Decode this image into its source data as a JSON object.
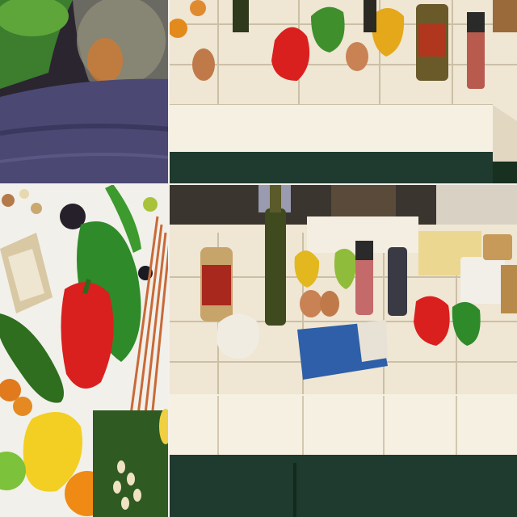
{
  "collage": {
    "panels": [
      {
        "id": "top-left",
        "scene": "close-up-fabric-and-fruit"
      },
      {
        "id": "top-right",
        "scene": "tiled-counter-with-peppers-and-cans"
      },
      {
        "id": "bottom-left",
        "scene": "vegetables-on-white-background"
      },
      {
        "id": "bottom-right",
        "scene": "kitchen-counter-with-ingredients"
      }
    ]
  },
  "colors": {
    "tile": "#f1e8d6",
    "grout": "#cbbfa6",
    "cabinet": "#1f3a2e",
    "red_pepper": "#d9201e",
    "green_pepper": "#2f8a2a",
    "yellow_pepper": "#e5c21a",
    "lemon": "#f2cf22",
    "orange": "#ef8a14",
    "fabric": "#4b4873"
  },
  "icons": [
    "red-pepper-icon",
    "green-pepper-icon",
    "cucumber-icon",
    "olive-oil-bottle-icon",
    "onion-icon",
    "butter-box-icon"
  ]
}
